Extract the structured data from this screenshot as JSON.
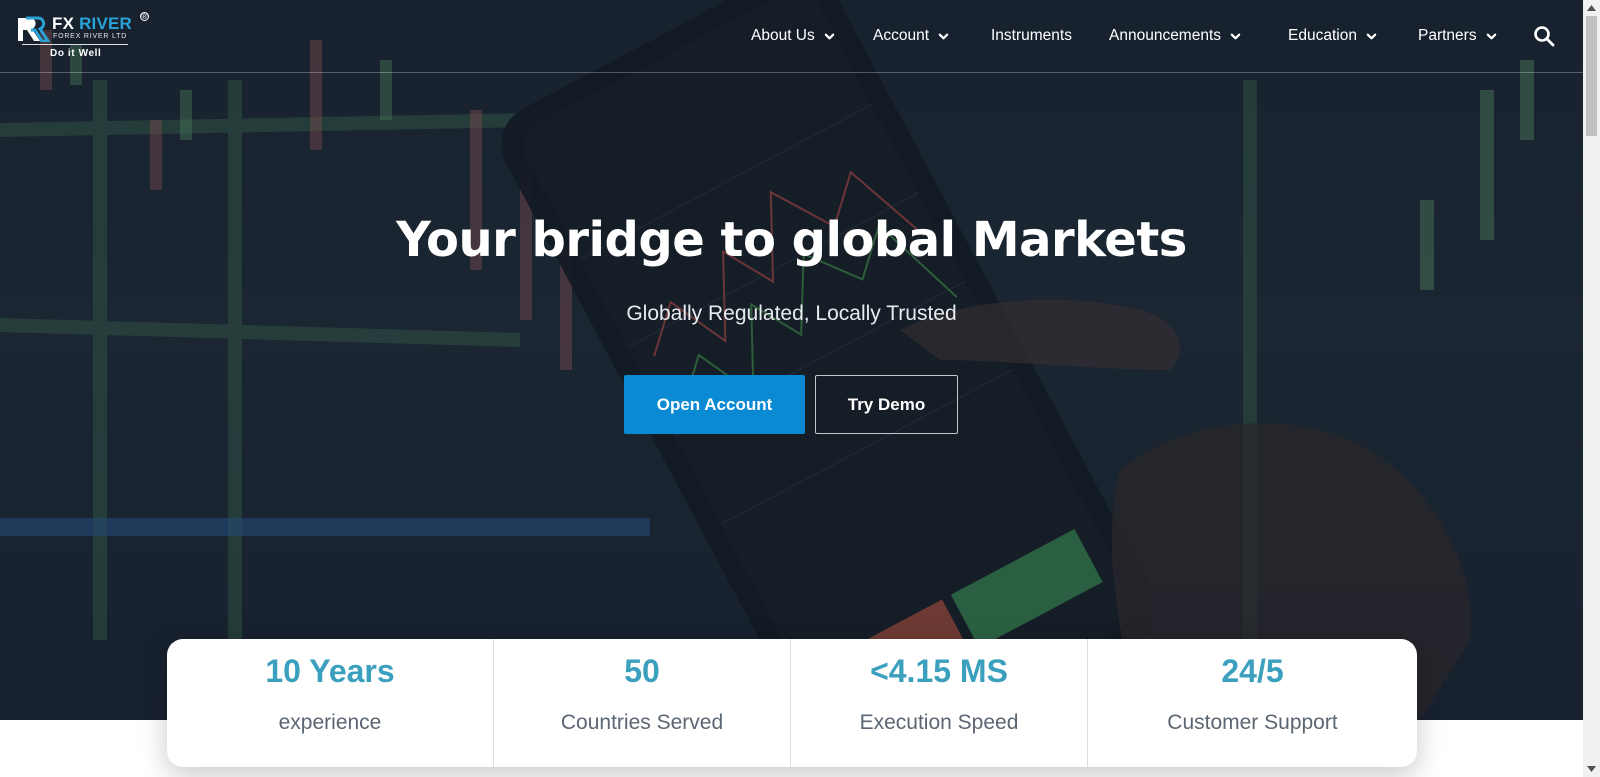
{
  "header": {
    "logo": {
      "name_part1": "FX",
      "name_part2": "RIVER",
      "subtitle": "FOREX RIVER LTD",
      "tagline": "Do it Well",
      "registered": "®"
    },
    "nav": [
      {
        "label": "About Us",
        "has_dropdown": true
      },
      {
        "label": "Account",
        "has_dropdown": true
      },
      {
        "label": "Instruments",
        "has_dropdown": false
      },
      {
        "label": "Announcements",
        "has_dropdown": true
      },
      {
        "label": "Education",
        "has_dropdown": true
      },
      {
        "label": "Partners",
        "has_dropdown": true
      }
    ],
    "search_icon": "search-icon"
  },
  "hero": {
    "title": "Your bridge to global Markets",
    "subtitle": "Globally Regulated, Locally Trusted",
    "primary_button": "Open Account",
    "secondary_button": "Try Demo"
  },
  "stats": [
    {
      "value": "10 Years",
      "label": "experience"
    },
    {
      "value": "50",
      "label": "Countries Served"
    },
    {
      "value": "<4.15 MS",
      "label": "Execution Speed"
    },
    {
      "value": "24/5",
      "label": "Customer Support"
    }
  ],
  "colors": {
    "accent": "#0a8ad3",
    "stat_value": "#3b9fbe",
    "brand_blue": "#2aa3d8"
  }
}
